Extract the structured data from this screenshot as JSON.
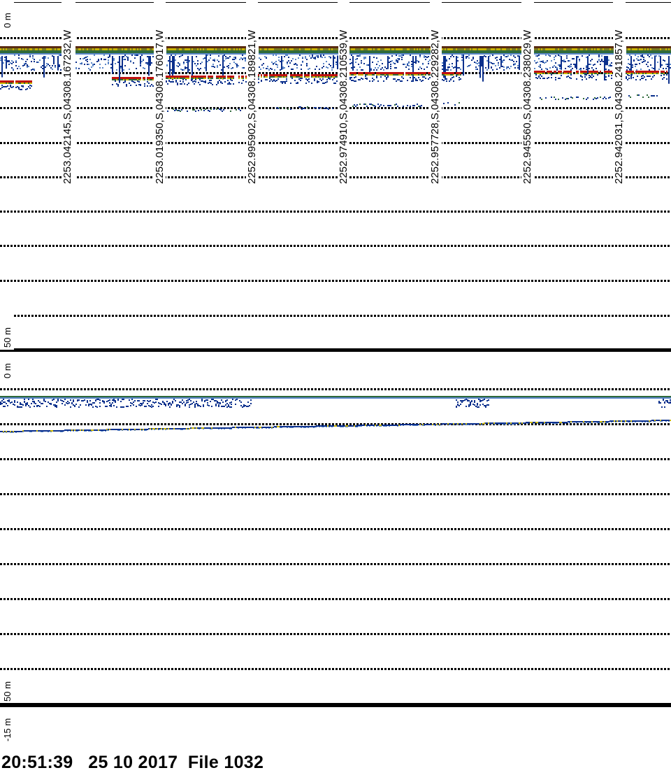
{
  "panels": [
    {
      "name": "upper-echogram",
      "top_label": "0 m",
      "bottom_label": "50 m"
    },
    {
      "name": "lower-echogram",
      "top_label": "0 m",
      "bottom_label": "50 m",
      "offset_label": "-15 m"
    }
  ],
  "positions": [
    "2253.042145,S,04308.167232,W",
    "2253.019350,S,04308.176017,W",
    "2252.995902,S,04308.189821,W",
    "2252.974910,S,04308.210539,W",
    "2252.957728,S,04308.229282,W",
    "2252.945560,S,04308.238029,W",
    "2252.942031,S,04308.241857,W"
  ],
  "footer": {
    "time": "20:51:39",
    "date": "25 10 2017",
    "file": "File 1032"
  },
  "colors": {
    "brown": "#5a2a10",
    "yellow": "#c8b400",
    "green": "#2f6a3a",
    "blue": "#0a2f8c",
    "lightblue": "#5a86c8",
    "red": "#c01010"
  }
}
